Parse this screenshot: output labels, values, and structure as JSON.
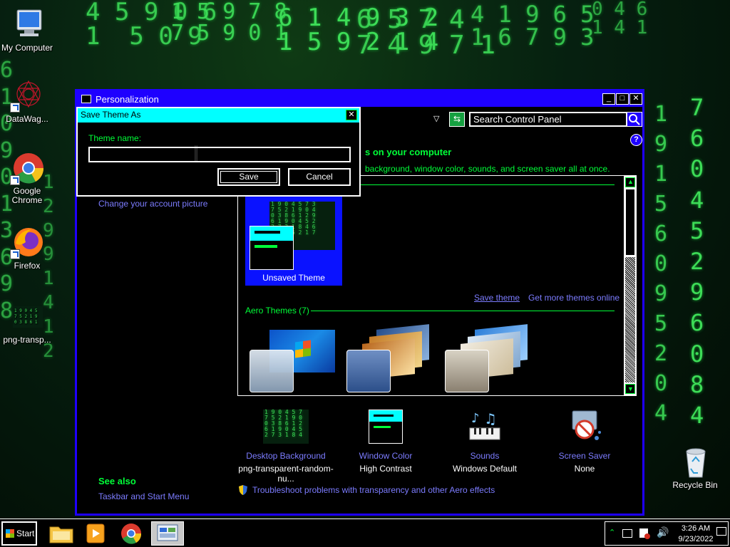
{
  "desktop": {
    "icons": [
      {
        "label": "My Computer",
        "icon": "my-computer-icon"
      },
      {
        "label": "DataWag...",
        "icon": "datawag-icon"
      },
      {
        "label": "Google Chrome",
        "icon": "chrome-icon"
      },
      {
        "label": "Firefox",
        "icon": "firefox-icon"
      },
      {
        "label": "png-transp...",
        "icon": "image-file-icon"
      },
      {
        "label": "Recycle Bin",
        "icon": "recycle-bin-icon"
      }
    ]
  },
  "window": {
    "title": "Personalization",
    "search_placeholder": "Search Control Panel",
    "heading_partial": "s on your computer",
    "description_partial": "background, window color, sounds, and screen saver all at once.",
    "left_link": "Change your account picture",
    "see_also_heading": "See also",
    "see_also_link": "Taskbar and Start Menu",
    "my_themes": {
      "selected_theme_label": "Unsaved Theme",
      "save_theme_link": "Save theme",
      "get_more_link": "Get more themes online"
    },
    "aero_section": {
      "label": "Aero Themes (7)"
    },
    "bottom_items": [
      {
        "label": "Desktop Background",
        "value": "png-transparent-random-nu..."
      },
      {
        "label": "Window Color",
        "value": "High Contrast"
      },
      {
        "label": "Sounds",
        "value": "Windows Default"
      },
      {
        "label": "Screen Saver",
        "value": "None"
      }
    ],
    "troubleshoot_link": "Troubleshoot problems with transparency and other Aero effects"
  },
  "dialog": {
    "title": "Save Theme As",
    "field_label": "Theme name:",
    "field_value": "",
    "save_label": "Save",
    "cancel_label": "Cancel"
  },
  "taskbar": {
    "start_label": "Start",
    "clock_time": "3:26 AM",
    "clock_date": "9/23/2022"
  },
  "colors": {
    "window_frame": "#1e00ff",
    "dialog_title": "#00ffff",
    "accent_green": "#00ff38",
    "link": "#7c7cff"
  }
}
